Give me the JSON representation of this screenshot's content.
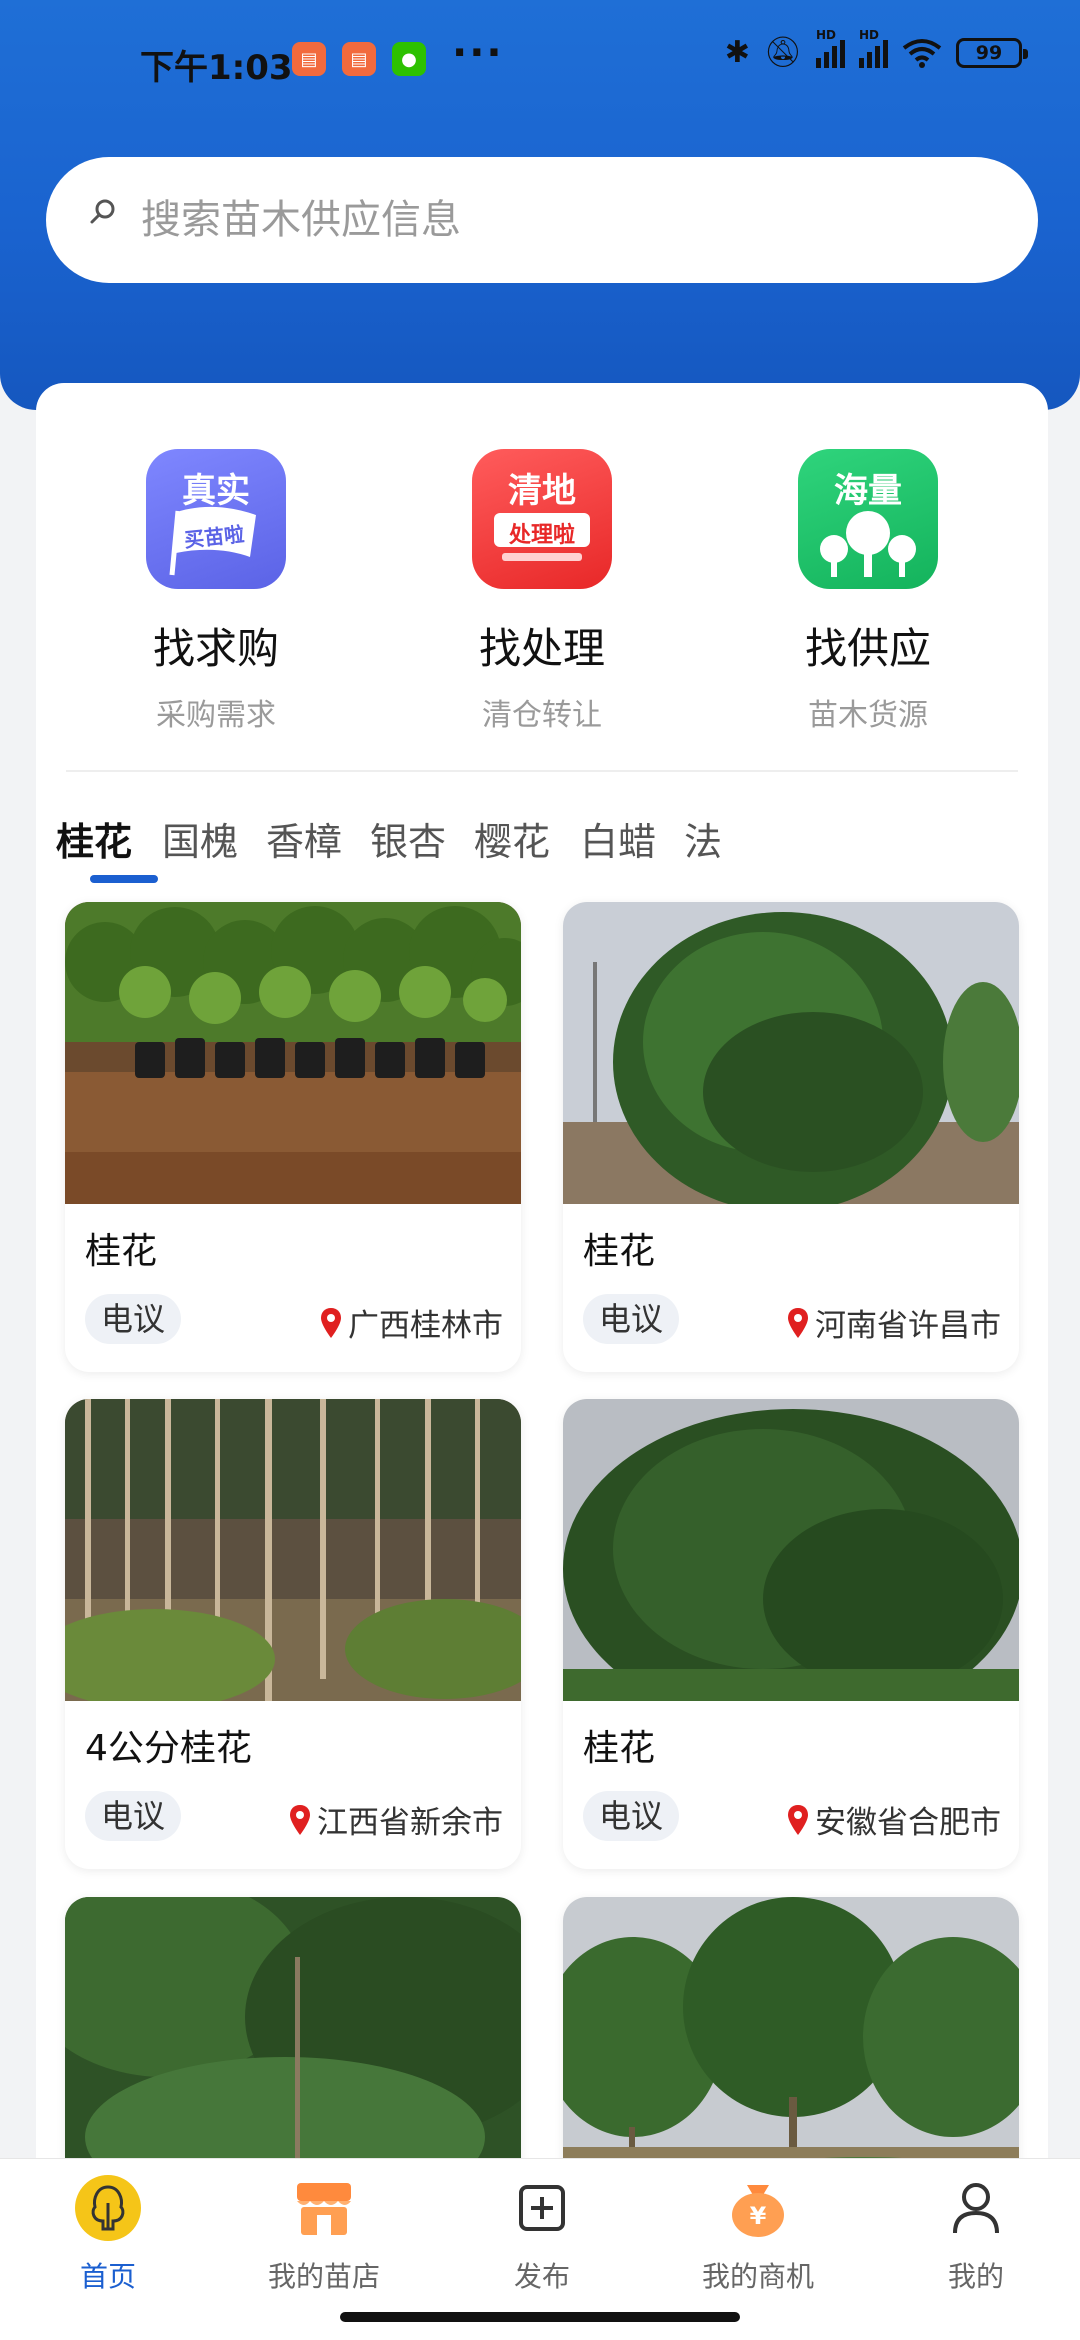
{
  "status_bar": {
    "time": "下午1:03",
    "battery": "99",
    "network_labels": [
      "HD",
      "HD"
    ]
  },
  "search": {
    "placeholder": "搜索苗木供应信息"
  },
  "quick_actions": [
    {
      "icon_text": "真实",
      "badge_text": "买苗啦",
      "title": "找求购",
      "subtitle": "采购需求",
      "color": "#6b74f0"
    },
    {
      "icon_text": "清地",
      "badge_text": "处理啦",
      "title": "找处理",
      "subtitle": "清仓转让",
      "color": "#f04040"
    },
    {
      "icon_text": "海量",
      "badge_text": "",
      "title": "找供应",
      "subtitle": "苗木货源",
      "color": "#21c26a"
    }
  ],
  "tabs": [
    "桂花",
    "国槐",
    "香樟",
    "银杏",
    "樱花",
    "白蜡",
    "法"
  ],
  "active_tab": "桂花",
  "products": [
    {
      "name": "桂花",
      "price": "电议",
      "location": "广西桂林市"
    },
    {
      "name": "桂花",
      "price": "电议",
      "location": "河南省许昌市"
    },
    {
      "name": "4公分桂花",
      "price": "电议",
      "location": "江西省新余市"
    },
    {
      "name": "桂花",
      "price": "电议",
      "location": "安徽省合肥市"
    }
  ],
  "bottom_nav": [
    {
      "label": "首页",
      "icon": "tree-icon",
      "active": true
    },
    {
      "label": "我的苗店",
      "icon": "shop-icon",
      "active": false
    },
    {
      "label": "发布",
      "icon": "plus-square-icon",
      "active": false
    },
    {
      "label": "我的商机",
      "icon": "money-bag-icon",
      "active": false
    },
    {
      "label": "我的",
      "icon": "user-icon",
      "active": false
    }
  ],
  "colors": {
    "header_blue": "#1a63cf",
    "accent_blue": "#1b5fd0",
    "nav_active_bg": "#f5c518"
  }
}
